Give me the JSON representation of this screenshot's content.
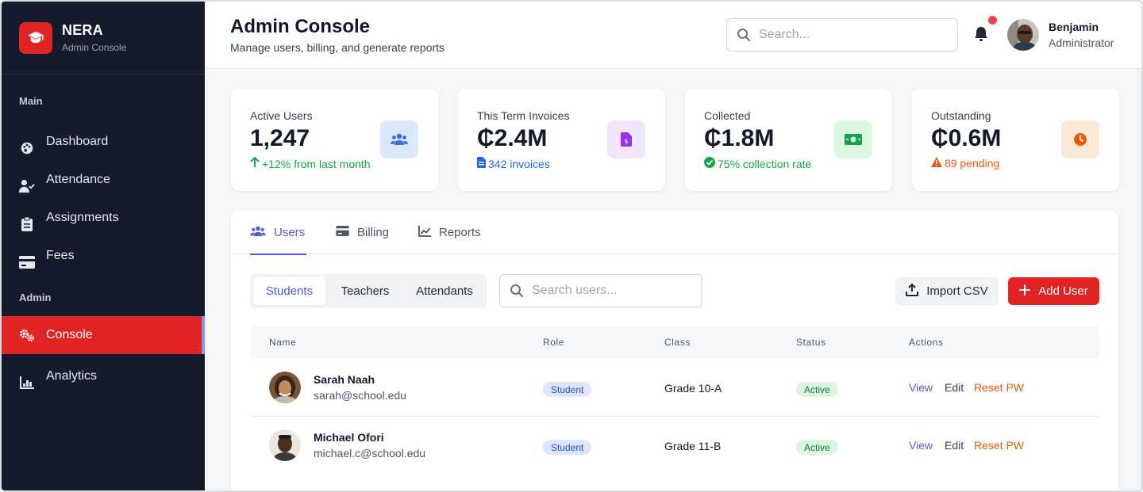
{
  "sidebar": {
    "brand_name": "NERA",
    "brand_sub": "Admin Console",
    "section_main": "Main",
    "section_admin": "Admin",
    "items": [
      {
        "label": "Dashboard",
        "icon": "palette-icon"
      },
      {
        "label": "Attendance",
        "icon": "user-check-icon"
      },
      {
        "label": "Assignments",
        "icon": "clipboard-icon"
      },
      {
        "label": "Fees",
        "icon": "credit-card-icon"
      },
      {
        "label": "Console",
        "icon": "gears-icon",
        "active": true
      },
      {
        "label": "Analytics",
        "icon": "bar-chart-icon"
      }
    ]
  },
  "header": {
    "title": "Admin Console",
    "subtitle": "Manage users, billing, and generate reports",
    "search_placeholder": "Search...",
    "user_name": "Benjamin",
    "user_role": "Administrator"
  },
  "stats": [
    {
      "label": "Active Users",
      "value": "1,247",
      "foot": "+12% from last month",
      "foot_color": "#16a34a",
      "icon": "users-icon",
      "icon_bg": "#dbe8fd",
      "icon_color": "#3b6fd8"
    },
    {
      "label": "This Term Invoices",
      "value": "₵2.4M",
      "foot": "342 invoices",
      "foot_color": "#2563eb",
      "icon": "invoice-icon",
      "icon_bg": "#f1e4fd",
      "icon_color": "#9333ea"
    },
    {
      "label": "Collected",
      "value": "₵1.8M",
      "foot": "75% collection rate",
      "foot_color": "#16a34a",
      "icon": "money-icon",
      "icon_bg": "#dcf7e4",
      "icon_color": "#16a34a"
    },
    {
      "label": "Outstanding",
      "value": "₵0.6M",
      "foot": "89 pending",
      "foot_color": "#ea580c",
      "icon": "clock-icon",
      "icon_bg": "#fde9d7",
      "icon_color": "#ea580c"
    }
  ],
  "tabs": [
    {
      "label": "Users",
      "icon": "users-icon",
      "active": true
    },
    {
      "label": "Billing",
      "icon": "card-icon"
    },
    {
      "label": "Reports",
      "icon": "line-chart-icon"
    }
  ],
  "segments": [
    {
      "label": "Students",
      "active": true
    },
    {
      "label": "Teachers"
    },
    {
      "label": "Attendants"
    }
  ],
  "user_search_placeholder": "Search users...",
  "buttons": {
    "import": "Import CSV",
    "add": "Add User"
  },
  "table": {
    "headers": [
      "Name",
      "Role",
      "Class",
      "Status",
      "Actions"
    ],
    "rows": [
      {
        "name": "Sarah Naah",
        "email": "sarah@school.edu",
        "role": "Student",
        "class": "Grade 10-A",
        "status": "Active",
        "actions": [
          "View",
          "Edit",
          "Reset PW"
        ]
      },
      {
        "name": "Michael Ofori",
        "email": "michael.c@school.edu",
        "role": "Student",
        "class": "Grade 11-B",
        "status": "Active",
        "actions": [
          "View",
          "Edit",
          "Reset PW"
        ]
      }
    ]
  },
  "colors": {
    "brand_red": "#e02424",
    "sidebar_bg": "#141b2d",
    "accent": "#4f5bd5"
  }
}
